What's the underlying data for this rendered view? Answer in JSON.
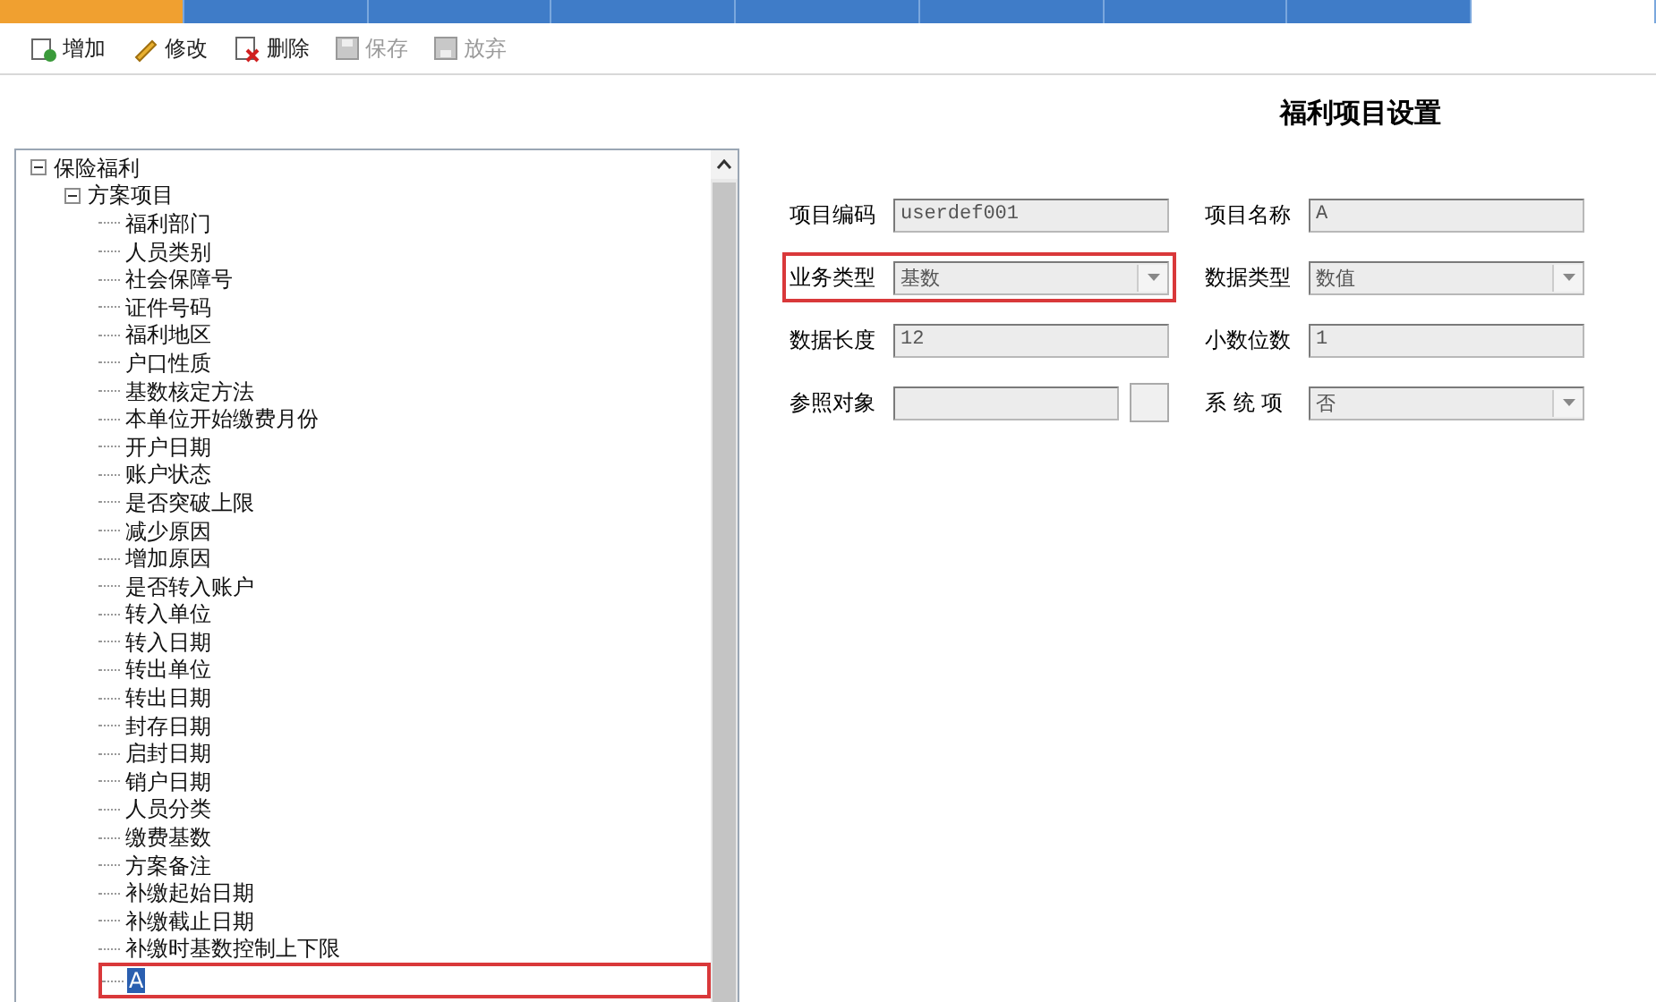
{
  "tabs": [
    {
      "selected": false,
      "accent": true
    },
    {
      "selected": false,
      "accent": false
    },
    {
      "selected": false,
      "accent": false
    },
    {
      "selected": false,
      "accent": false
    },
    {
      "selected": false,
      "accent": false
    },
    {
      "selected": false,
      "accent": false
    },
    {
      "selected": false,
      "accent": false
    },
    {
      "selected": false,
      "accent": false
    },
    {
      "selected": true,
      "accent": false
    }
  ],
  "toolbar": [
    {
      "label": "增加",
      "kind": "add",
      "disabled": false
    },
    {
      "label": "修改",
      "kind": "edit",
      "disabled": false
    },
    {
      "label": "删除",
      "kind": "delete",
      "disabled": false
    },
    {
      "label": "保存",
      "kind": "save",
      "disabled": true
    },
    {
      "label": "放弃",
      "kind": "discard",
      "disabled": true
    }
  ],
  "tree": [
    {
      "label": "保险福利",
      "expanded": true,
      "selected": false,
      "children": [
        {
          "label": "方案项目",
          "expanded": true,
          "selected": false,
          "children": [
            {
              "label": "福利部门",
              "selected": false
            },
            {
              "label": "人员类别",
              "selected": false
            },
            {
              "label": "社会保障号",
              "selected": false
            },
            {
              "label": "证件号码",
              "selected": false
            },
            {
              "label": "福利地区",
              "selected": false
            },
            {
              "label": "户口性质",
              "selected": false
            },
            {
              "label": "基数核定方法",
              "selected": false
            },
            {
              "label": "本单位开始缴费月份",
              "selected": false
            },
            {
              "label": "开户日期",
              "selected": false
            },
            {
              "label": "账户状态",
              "selected": false
            },
            {
              "label": "是否突破上限",
              "selected": false
            },
            {
              "label": "减少原因",
              "selected": false
            },
            {
              "label": "增加原因",
              "selected": false
            },
            {
              "label": "是否转入账户",
              "selected": false
            },
            {
              "label": "转入单位",
              "selected": false
            },
            {
              "label": "转入日期",
              "selected": false
            },
            {
              "label": "转出单位",
              "selected": false
            },
            {
              "label": "转出日期",
              "selected": false
            },
            {
              "label": "封存日期",
              "selected": false
            },
            {
              "label": "启封日期",
              "selected": false
            },
            {
              "label": "销户日期",
              "selected": false
            },
            {
              "label": "人员分类",
              "selected": false
            },
            {
              "label": "缴费基数",
              "selected": false
            },
            {
              "label": "方案备注",
              "selected": false
            },
            {
              "label": "补缴起始日期",
              "selected": false
            },
            {
              "label": "补缴截止日期",
              "selected": false
            },
            {
              "label": "补缴时基数控制上下限",
              "selected": false
            },
            {
              "label": "A",
              "selected": true
            }
          ]
        }
      ]
    }
  ],
  "form": {
    "title": "福利项目设置",
    "fields": [
      {
        "label": "项目编码",
        "value": "userdef001",
        "kind": "text",
        "highlighted": false
      },
      {
        "label": "项目名称",
        "value": "A",
        "kind": "text",
        "highlighted": false
      },
      {
        "label": "业务类型",
        "value": "基数",
        "kind": "select",
        "highlighted": true
      },
      {
        "label": "数据类型",
        "value": "数值",
        "kind": "select",
        "highlighted": false
      },
      {
        "label": "数据长度",
        "value": "12",
        "kind": "text",
        "highlighted": false
      },
      {
        "label": "小数位数",
        "value": "1",
        "kind": "text",
        "highlighted": false
      },
      {
        "label": "参照对象",
        "kind": "lookup",
        "highlighted": false
      },
      {
        "label": "系 统 项",
        "value": "否",
        "kind": "select",
        "highlighted": false
      }
    ]
  }
}
